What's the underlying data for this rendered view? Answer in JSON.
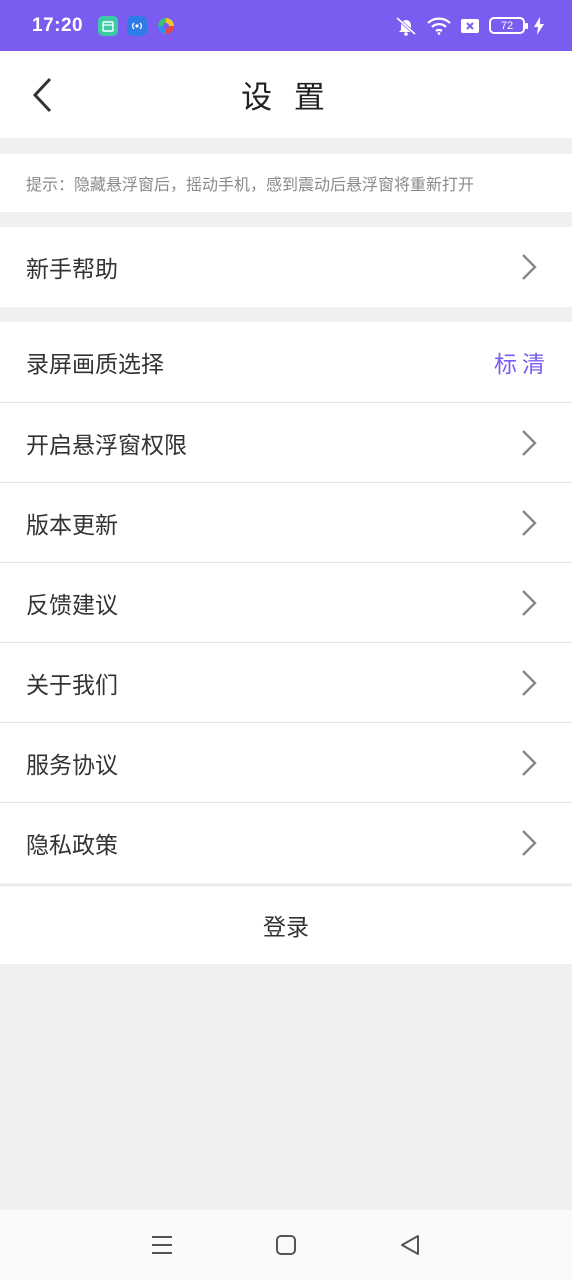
{
  "status_bar": {
    "time": "17:20",
    "battery": "72",
    "accent": "#7b5cf0",
    "icons": [
      "calendar-app-icon",
      "broadcast-app-icon",
      "colorful-app-icon",
      "mute-icon",
      "wifi-icon",
      "sim-blocked-icon",
      "battery-icon",
      "charging-icon"
    ]
  },
  "header": {
    "title": "设 置",
    "back_icon": "chevron-left-icon"
  },
  "tip": "提示：隐藏悬浮窗后，摇动手机，感到震动后悬浮窗将重新打开",
  "group1": [
    {
      "label": "新手帮助"
    }
  ],
  "quality": {
    "label": "录屏画质选择",
    "value": "标清"
  },
  "group2": [
    {
      "label": "开启悬浮窗权限"
    },
    {
      "label": "版本更新"
    },
    {
      "label": "反馈建议"
    },
    {
      "label": "关于我们"
    },
    {
      "label": "服务协议"
    },
    {
      "label": "隐私政策"
    }
  ],
  "login_label": "登录",
  "system_nav": [
    "menu-icon",
    "home-icon",
    "back-triangle-icon"
  ]
}
